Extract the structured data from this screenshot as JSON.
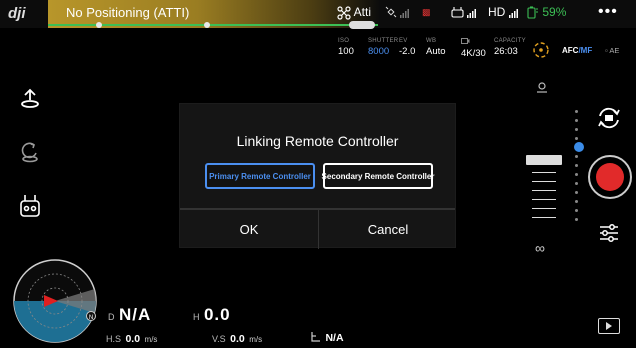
{
  "top_bar": {
    "logo_text": "dji",
    "flight_mode": "No Positioning (ATTI)",
    "atti_label": "Atti",
    "hd_label": "HD",
    "battery_percent": "59%",
    "flight_progress": 0.5,
    "colors": {
      "mode_strip": "#b8962a",
      "progress": "#3cbf55",
      "battery": "#3cbf55",
      "warning": "#dd3333"
    }
  },
  "camera": {
    "iso_label": "ISO",
    "iso_value": "100",
    "shutter_label": "SHUTTER",
    "shutter_value": "8000",
    "ev_label": "EV",
    "ev_value": "-2.0",
    "wb_label": "WB",
    "wb_value": "Auto",
    "video_label": "",
    "video_value": "4K/30",
    "capacity_label": "CAPACITY",
    "capacity_value": "26:03",
    "focus_mode_afc": "AFC",
    "focus_mode_mf": "/MF",
    "ae_label": "AE"
  },
  "dialog": {
    "title": "Linking Remote Controller",
    "primary_label": "Primary Remote Controller",
    "secondary_label": "Secondary Remote Controller",
    "ok_label": "OK",
    "cancel_label": "Cancel"
  },
  "telemetry": {
    "d_label": "D",
    "d_value": "N/A",
    "h_label": "H",
    "h_value": "0.0",
    "hs_label": "H.S",
    "hs_value": "0.0",
    "hs_unit": "m/s",
    "vs_label": "V.S",
    "vs_value": "0.0",
    "vs_unit": "m/s",
    "home_value": "N/A",
    "north_label": "N"
  },
  "right_panel": {
    "infinity_label": "∞"
  }
}
